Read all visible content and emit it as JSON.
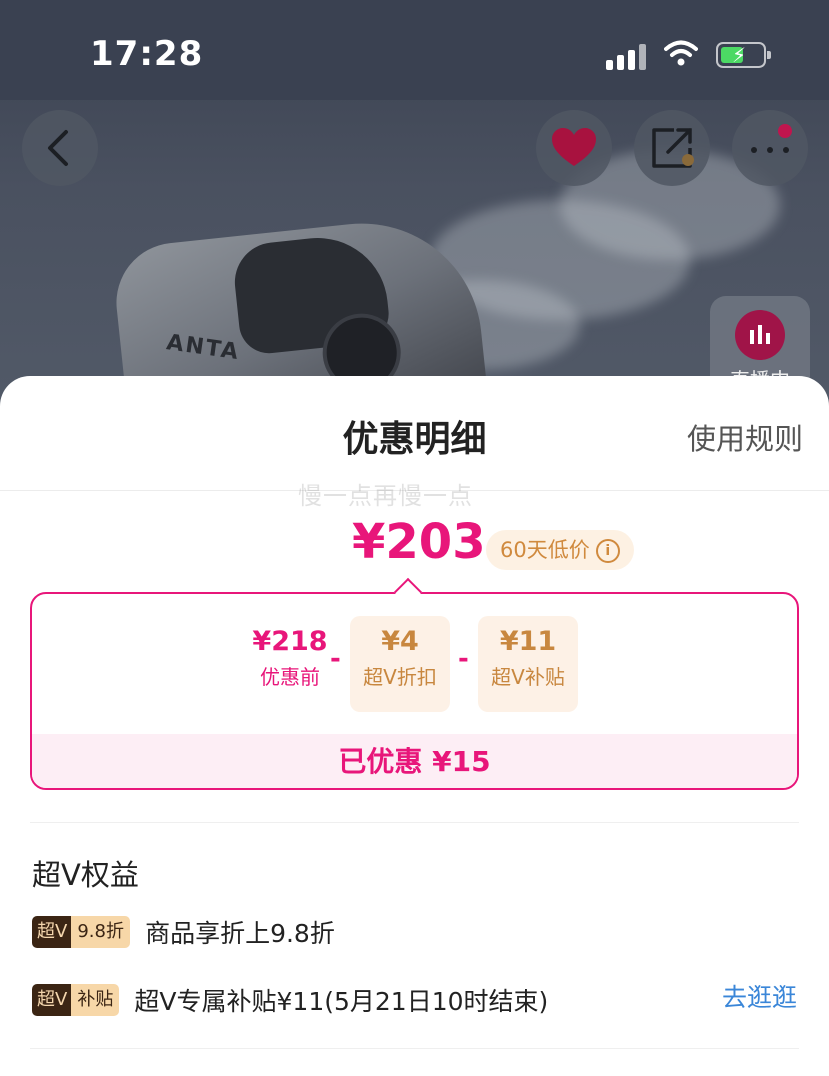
{
  "status_bar": {
    "time": "17:28"
  },
  "product_page": {
    "brand_text": "ANTA",
    "live_label": "直播中"
  },
  "sheet": {
    "title": "优惠明细",
    "rules_link": "使用规则",
    "watermark": "慢一点再慢一点",
    "final_price": "¥203",
    "low_price_badge": "60天低价",
    "info_icon": "i",
    "breakdown": {
      "original_amount": "¥218",
      "original_label": "优惠前",
      "minus_sign": "-",
      "discount_amount": "¥4",
      "discount_label": "超V折扣",
      "subsidy_amount": "¥11",
      "subsidy_label": "超V补贴",
      "saved_text": "已优惠 ¥15"
    },
    "benefits": {
      "section_title": "超V权益",
      "items": [
        {
          "tag_left": "超V",
          "tag_right": "9.8折",
          "text": "商品享折上9.8折"
        },
        {
          "tag_left": "超V",
          "tag_right": "补贴",
          "text": "超V专属补贴¥11(5月21日10时结束)",
          "link": "去逛逛"
        }
      ]
    }
  },
  "colors": {
    "accent_pink": "#e8167a",
    "gold": "#c8873f",
    "link_blue": "#3a86d8"
  }
}
